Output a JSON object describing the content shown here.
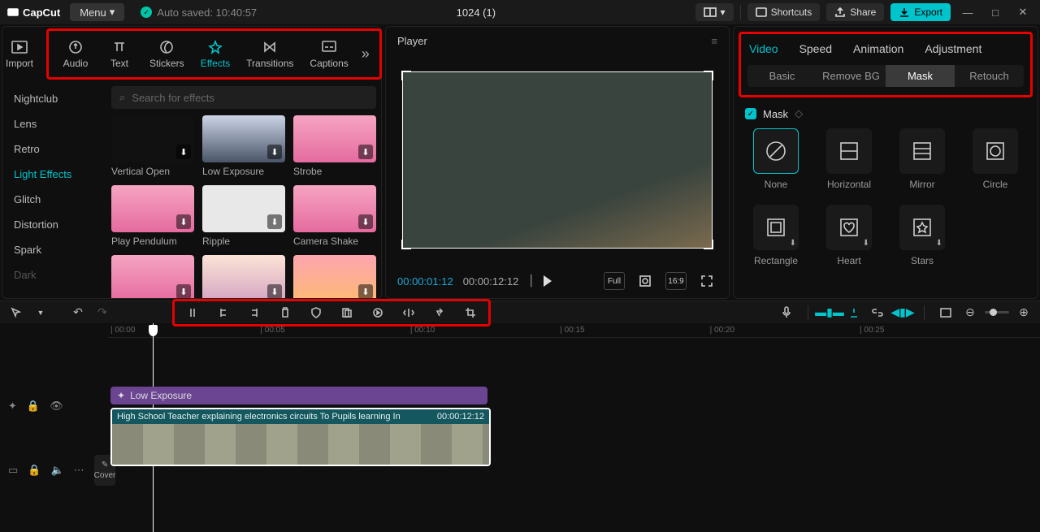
{
  "titlebar": {
    "logo": "CapCut",
    "menu": "Menu",
    "autosave": "Auto saved: 10:40:57",
    "project": "1024 (1)",
    "shortcuts": "Shortcuts",
    "share": "Share",
    "export": "Export"
  },
  "tooltabs": {
    "import": "Import",
    "audio": "Audio",
    "text": "Text",
    "stickers": "Stickers",
    "effects": "Effects",
    "transitions": "Transitions",
    "captions": "Captions"
  },
  "categories": [
    "Nightclub",
    "Lens",
    "Retro",
    "Light Effects",
    "Glitch",
    "Distortion",
    "Spark",
    "Dark"
  ],
  "search_placeholder": "Search for effects",
  "effects": [
    {
      "label": "Vertical Open",
      "cls": "dark"
    },
    {
      "label": "Low Exposure",
      "cls": "city"
    },
    {
      "label": "Strobe",
      "cls": "pink"
    },
    {
      "label": "Play Pendulum",
      "cls": "pink"
    },
    {
      "label": "Ripple",
      "cls": "white"
    },
    {
      "label": "Camera Shake",
      "cls": "pink"
    },
    {
      "label": "",
      "cls": "pink"
    },
    {
      "label": "",
      "cls": "sunset"
    },
    {
      "label": "",
      "cls": "orange"
    }
  ],
  "player": {
    "title": "Player",
    "current": "00:00:01:12",
    "total": "00:00:12:12",
    "ratio": "16:9",
    "full": "Full"
  },
  "right": {
    "tabs": [
      "Video",
      "Speed",
      "Animation",
      "Adjustment"
    ],
    "subtabs": [
      "Basic",
      "Remove BG",
      "Mask",
      "Retouch"
    ],
    "mask_title": "Mask",
    "masks": [
      "None",
      "Horizontal",
      "Mirror",
      "Circle",
      "Rectangle",
      "Heart",
      "Stars"
    ]
  },
  "timeline": {
    "cover": "Cover",
    "ruler": [
      "00:00",
      "00:05",
      "00:10",
      "00:15",
      "00:20",
      "00:25"
    ],
    "fx_label": "Low Exposure",
    "clip_title": "High School Teacher explaining electronics circuits To Pupils learning In",
    "clip_dur": "00:00:12:12"
  }
}
